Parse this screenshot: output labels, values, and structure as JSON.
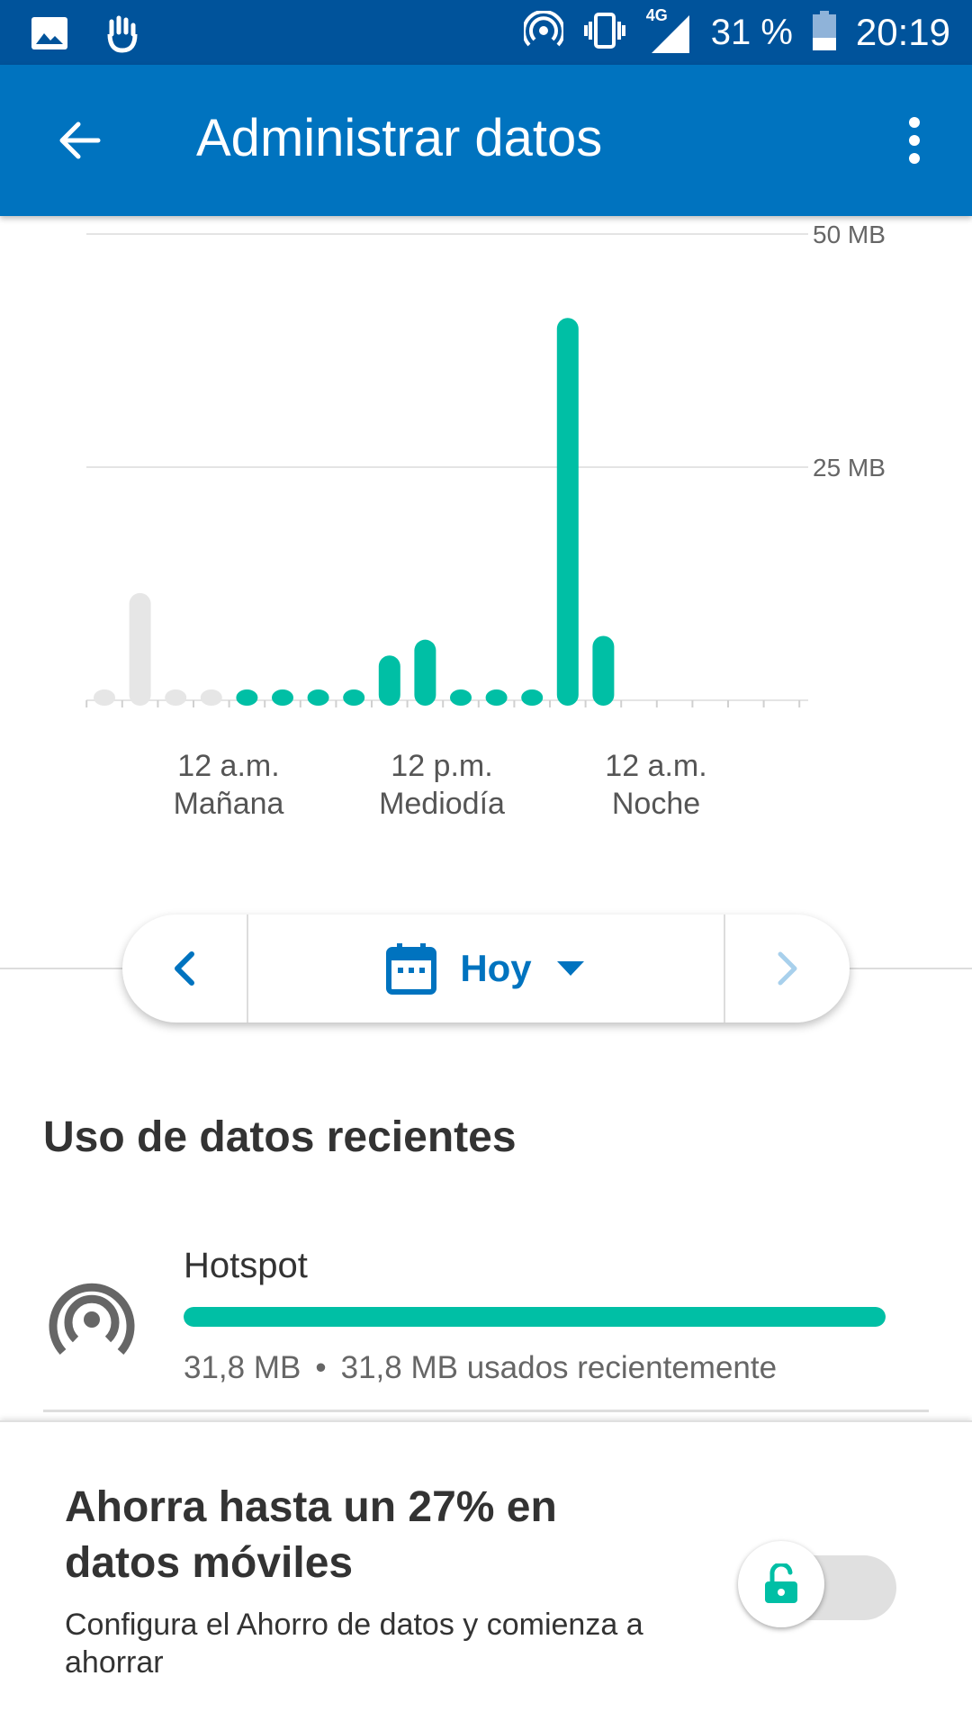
{
  "status_bar": {
    "battery_percent": "31 %",
    "time": "20:19",
    "network": "4G",
    "icons": [
      "image-icon",
      "hand-icon",
      "hotspot-icon",
      "vibrate-icon",
      "signal-icon",
      "battery-icon"
    ]
  },
  "app_bar": {
    "title": "Administrar datos",
    "back_icon": "arrow-back-icon",
    "more_icon": "more-vert-icon",
    "background": "#0073bf"
  },
  "chart_data": {
    "type": "bar",
    "y_ticks": [
      "50 MB",
      "25 MB"
    ],
    "ylim": [
      0,
      50
    ],
    "x_tick_labels": [
      {
        "time": "12 a.m.",
        "period": "Mañana"
      },
      {
        "time": "12 p.m.",
        "period": "Mediodía"
      },
      {
        "time": "12 a.m.",
        "period": "Noche"
      }
    ],
    "series": [
      {
        "color": "#e6e6e6",
        "values": [
          0.5,
          11.5,
          0.5,
          0.5,
          null,
          null,
          null,
          null,
          null,
          null,
          null,
          null,
          null,
          null,
          null
        ]
      },
      {
        "color": "#00bfa5",
        "values": [
          null,
          null,
          null,
          null,
          0.5,
          0.5,
          0.5,
          0.5,
          4.8,
          6.5,
          0.5,
          0.5,
          0.5,
          41,
          6.9
        ]
      }
    ],
    "grid": true
  },
  "date_selector": {
    "label": "Hoy",
    "prev_icon": "chevron-left-icon",
    "next_icon": "chevron-right-icon",
    "calendar_icon": "calendar-icon",
    "dropdown_icon": "dropdown-arrow-icon"
  },
  "recent_usage": {
    "title": "Uso de datos recientes",
    "items": [
      {
        "name": "Hotspot",
        "icon": "hotspot-icon",
        "amount": "31,8 MB",
        "detail": "31,8 MB usados recientemente",
        "fraction": 1.0
      }
    ]
  },
  "saver_card": {
    "title": "Ahorra hasta un 27% en datos móviles",
    "subtitle": "Configura el Ahorro de datos y comienza a ahorrar",
    "toggle_icon": "lock-open-icon",
    "toggle_on": false
  }
}
